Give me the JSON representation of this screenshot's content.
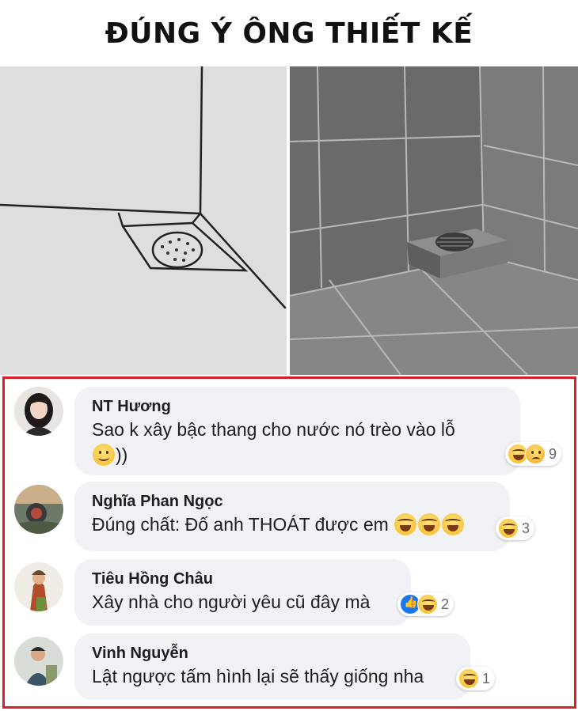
{
  "title": "ĐÚNG Ý ÔNG THIẾT KẾ",
  "colors": {
    "frame_border": "#d61f26",
    "bubble_bg": "#f0f2f5",
    "text": "#1c1e21",
    "muted": "#65676b"
  },
  "photos": {
    "left_icon": "drawing-floor-drain",
    "right_icon": "tiled-floor-drain"
  },
  "comments": [
    {
      "name": "NT Hương",
      "text_line1": "Sao k xây bậc thang cho nước nó trèo vào lỗ",
      "text_line2": "))",
      "reactions": [
        "haha-icon",
        "sad-icon"
      ],
      "count": "9"
    },
    {
      "name": "Nghĩa Phan Ngọc",
      "text": "Đúng chất: Đố anh THOÁT được em",
      "reactions": [
        "haha-icon"
      ],
      "count": "3"
    },
    {
      "name": "Tiêu Hồng Châu",
      "text": "Xây nhà cho người yêu cũ đây mà",
      "reactions": [
        "like-icon",
        "haha-icon"
      ],
      "count": "2"
    },
    {
      "name": "Vinh Nguyễn",
      "text": "Lật ngược tấm hình lại sẽ thấy giống nha",
      "reactions": [
        "haha-icon"
      ],
      "count": "1"
    }
  ]
}
